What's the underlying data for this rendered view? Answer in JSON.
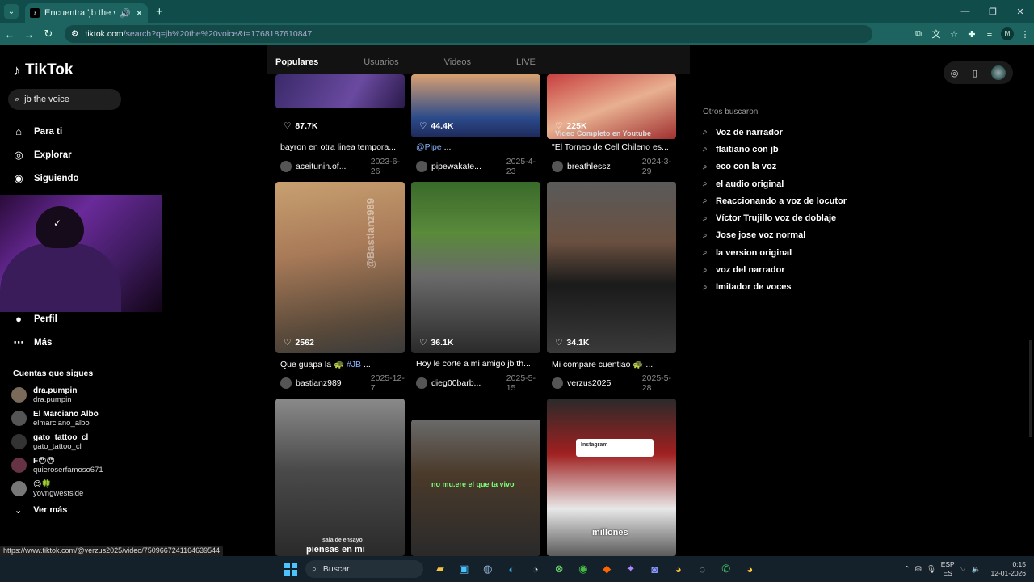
{
  "browser": {
    "tab_title": "Encuentra 'jb the voice' en",
    "url_host": "tiktok.com",
    "url_path": "/search?q=jb%20the%20voice&t=1768187610847",
    "profile_initial": "M",
    "accent": "#0f4c4a"
  },
  "sidebar": {
    "logo": "TikTok",
    "search_value": "jb the voice",
    "menu": [
      {
        "label": "Para ti",
        "icon": "home-icon"
      },
      {
        "label": "Explorar",
        "icon": "compass-icon"
      },
      {
        "label": "Siguiendo",
        "icon": "following-icon"
      }
    ],
    "menu_lower": [
      {
        "label": "Perfil",
        "icon": "profile-icon"
      },
      {
        "label": "Más",
        "icon": "more-icon"
      }
    ],
    "following_title": "Cuentas que sigues",
    "following": [
      {
        "name": "dra.pumpin",
        "user": "dra.pumpin"
      },
      {
        "name": "El Marciano Albo",
        "user": "elmarciano_albo"
      },
      {
        "name": "gato_tattoo_cl",
        "user": "gato_tattoo_cl"
      },
      {
        "name": "F😍😍",
        "user": "quieroserfamoso671"
      },
      {
        "name": "😊🍀",
        "user": "yovngwestside"
      }
    ],
    "see_more": "Ver más"
  },
  "tabs": [
    "Populares",
    "Usuarios",
    "Videos",
    "LIVE"
  ],
  "videos": [
    {
      "likes": "87.7K",
      "caption": "bayron en otra linea tempora...",
      "user": "aceitunin.of...",
      "date": "2023-6-26",
      "overlay": ""
    },
    {
      "likes": "44.4K",
      "caption_tag": "@Pipe",
      "caption": " ...",
      "user": "pipewakate...",
      "date": "2025-4-23",
      "overlay": ""
    },
    {
      "likes": "225K",
      "caption": "\"El Torneo de Cell Chileno es...",
      "user": "breathlessz",
      "date": "2024-3-29",
      "overlay": "Video Completo en Youtube"
    },
    {
      "likes": "2562",
      "caption": "Que guapa la 🐢 ",
      "caption_tag": "#JB",
      "caption_tail": " ...",
      "user": "bastianz989",
      "date": "2025-12-7",
      "overlay": "@Bastianz989"
    },
    {
      "likes": "36.1K",
      "caption": "Hoy le corte a mi amigo jb th...",
      "user": "dieg00barb...",
      "date": "2025-5-15",
      "overlay": ""
    },
    {
      "likes": "34.1K",
      "caption": "Mi compare cuentiao 🐢 ...",
      "user": "verzus2025",
      "date": "2025-5-28",
      "overlay": ""
    },
    {
      "overlay": "piensas en mi",
      "overlay2": "sala de ensayo"
    },
    {
      "overlay": "no mu.ere el que ta vivo"
    },
    {
      "overlay": "millones",
      "overlay2": "Instagram"
    }
  ],
  "right": {
    "others_title": "Otros buscaron",
    "others": [
      "Voz de narrador",
      "flaitiano con jb",
      "eco con la voz",
      "el audio original",
      "Reaccionando a voz de locutor",
      "Víctor Trujillo voz de doblaje",
      "Jose jose voz normal",
      "la version original",
      "voz del narrador",
      "Imitador de voces"
    ]
  },
  "statusbar": "https://www.tiktok.com/@verzus2025/video/7509667241164639544",
  "taskbar": {
    "search_placeholder": "Buscar",
    "lang_top": "ESP",
    "lang_bottom": "ES",
    "time": "0:15",
    "date": "12-01-2026"
  }
}
